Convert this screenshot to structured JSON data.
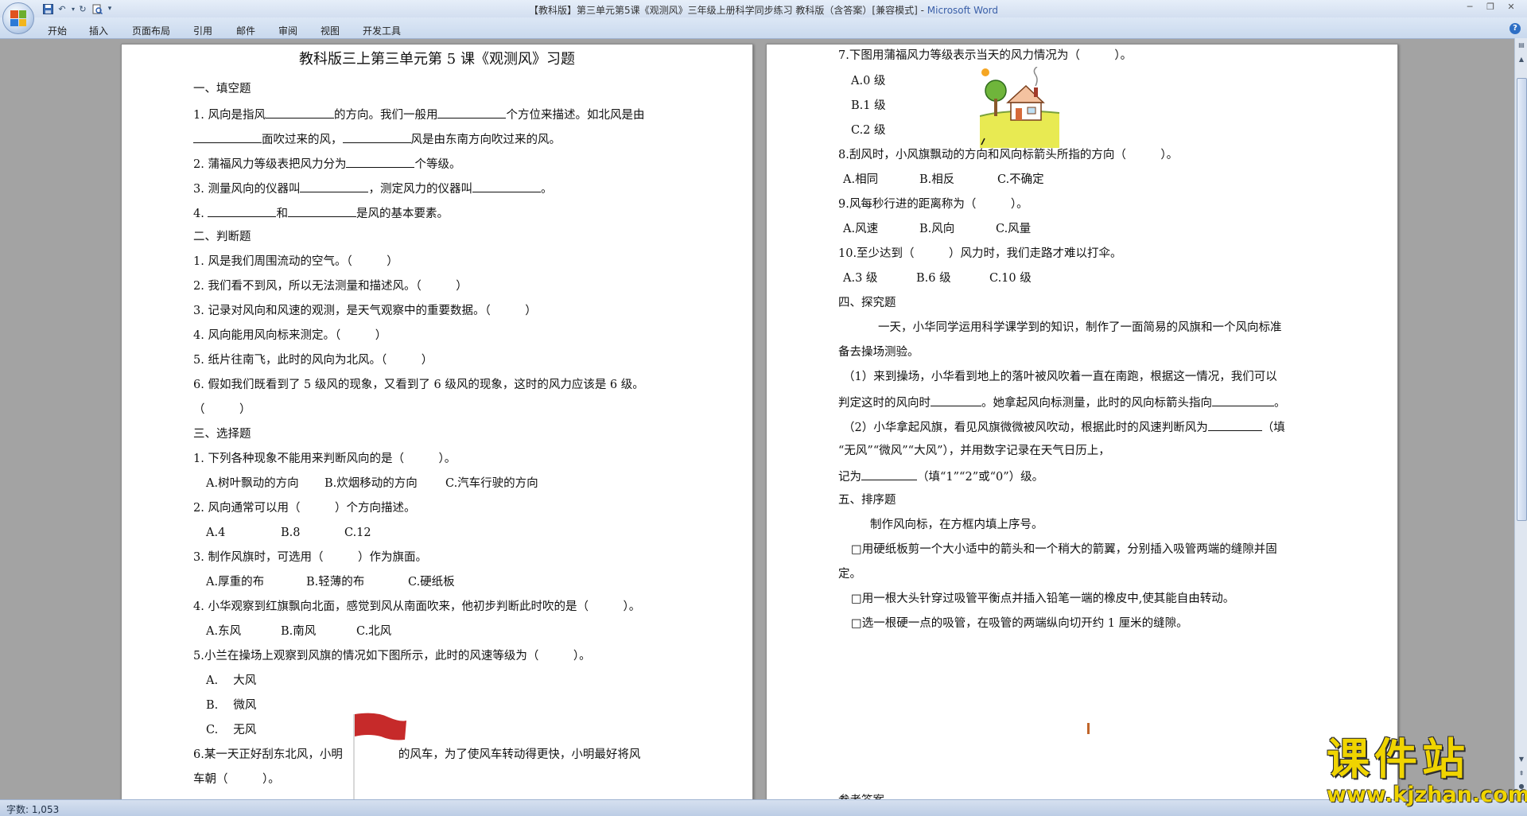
{
  "window": {
    "title_doc": "【教科版】第三单元第5课《观测风》三年级上册科学同步练习 教科版（含答案）[兼容模式] - ",
    "title_app": "Microsoft Word",
    "qat_dropdown": "▾"
  },
  "ribbon": {
    "tabs": [
      "开始",
      "插入",
      "页面布局",
      "引用",
      "邮件",
      "审阅",
      "视图",
      "开发工具"
    ],
    "help": "?"
  },
  "page_left": {
    "title": "教科版三上第三单元第 5 课《观测风》习题",
    "s1_title": "一、填空题",
    "fill": {
      "q1_a": "1. 风向是指风",
      "q1_b": "的方向。我们一般用",
      "q1_c": "个方位来描述。如北风是由",
      "q1_d": "面吹过来的风，",
      "q1_e": "风是由东南方向吹过来的风。",
      "q2_a": "2. 蒲福风力等级表把风力分为",
      "q2_b": "个等级。",
      "q3_a": "3. 测量风向的仪器叫",
      "q3_b": "，测定风力的仪器叫",
      "q3_c": "。",
      "q4_a": "4.",
      "q4_b": "和",
      "q4_c": "是风的基本要素。"
    },
    "s2_title": "二、判断题",
    "judge": [
      "1. 风是我们周围流动的空气。（　　　）",
      "2. 我们看不到风，所以无法测量和描述风。（　　　）",
      "3. 记录对风向和风速的观测，是天气观察中的重要数据。（　　　）",
      "4. 风向能用风向标来测定。（　　　）",
      "5. 纸片往南飞，此时的风向为北风。（　　　）",
      "6. 假如我们既看到了 5 级风的现象，又看到了 6 级风的现象，这时的风力应该是 6 级。",
      "（　　　）"
    ],
    "s3_title": "三、选择题",
    "choice": {
      "q1": "1. 下列各种现象不能用来判断风向的是（　　　）。",
      "q1_opts": [
        "A.树叶飘动的方向",
        "B.炊烟移动的方向",
        "C.汽车行驶的方向"
      ],
      "q2": "2. 风向通常可以用（　　　）个方向描述。",
      "q2_opts": [
        "A.4",
        "B.8",
        "C.12"
      ],
      "q3": "3. 制作风旗时，可选用（　　　）作为旗面。",
      "q3_opts": [
        "A.厚重的布",
        "B.轻薄的布",
        "C.硬纸板"
      ],
      "q4": "4. 小华观察到红旗飘向北面，感觉到风从南面吹来，他初步判断此时吹的是（　　　）。",
      "q4_opts": [
        "A.东风",
        "B.南风",
        "C.北风"
      ],
      "q5": "5.小兰在操场上观察到风旗的情况如下图所示，此时的风速等级为（　　　）。",
      "q5_opts": [
        "A.　 大风",
        "B.　 微风",
        "C.　 无风"
      ],
      "q6_a": "6.某一天正好刮东北风，小明",
      "q6_b": "的风车，为了使风车转动得更快，小明最好将风",
      "q6_c": "车朝（　　　）。"
    }
  },
  "page_right": {
    "choice": {
      "q7": "7.下图用蒲福风力等级表示当天的风力情况为（　　　）。",
      "q7_opts": [
        "A.0 级",
        "B.1 级",
        "C.2 级"
      ],
      "q8": "8.刮风时，小风旗飘动的方向和风向标箭头所指的方向（　　　）。",
      "q8_opts": [
        "A.相同",
        "B.相反",
        "C.不确定"
      ],
      "q9": "9.风每秒行进的距离称为（　　　）。",
      "q9_opts": [
        "A.风速",
        "B.风向",
        "C.风量"
      ],
      "q10": "10.至少达到（　　　）风力时，我们走路才难以打伞。",
      "q10_opts": [
        "A.3 级",
        "B.6 级",
        "C.10 级"
      ]
    },
    "s4_title": "四、探究题",
    "inquiry": {
      "intro_1": "一天，小华同学运用科学课学到的知识，制作了一面简易的风旗和一个风向标准",
      "intro_2": "备去操场测验。",
      "p1_a": "（1）来到操场，小华看到地上的落叶被风吹着一直在南跑，根据这一情况，我们可以",
      "p1_b": "判定这时的风向时",
      "p1_c": "。她拿起风向标测量，此时的风向标箭头指向",
      "p1_d": "。",
      "p2_a": "（2）小华拿起风旗，看见风旗微微被风吹动，根据此时的风速判断风为",
      "p2_b": "（填",
      "p2_c": "“无风”“微风”“大风”），并用数字记录在天气日历上，",
      "p2_d": "记为",
      "p2_e": "（填“1”“2”或“0”）级。"
    },
    "s5_title": "五、排序题",
    "order": {
      "intro": "制作风向标，在方框内填上序号。",
      "i1_a": "□用硬纸板剪一个大小适中的箭头和一个稍大的箭翼，分别插入吸管两端的缝隙并固",
      "i1_b": "定。",
      "i2": "□用一根大头针穿过吸管平衡点并插入铅笔一端的橡皮中,使其能自由转动。",
      "i3": "□选一根硬一点的吸管，在吸管的两端纵向切开约 1 厘米的缝隙。"
    },
    "answer_heading": "参考答案"
  },
  "statusbar": {
    "word_count": "字数: 1,053"
  },
  "watermark": {
    "title": "课件站",
    "url": "www.kjzhan.com"
  },
  "colors": {
    "accent": "#3a5fa8",
    "watermark": "#f0d400",
    "flag": "#c62a2a"
  }
}
